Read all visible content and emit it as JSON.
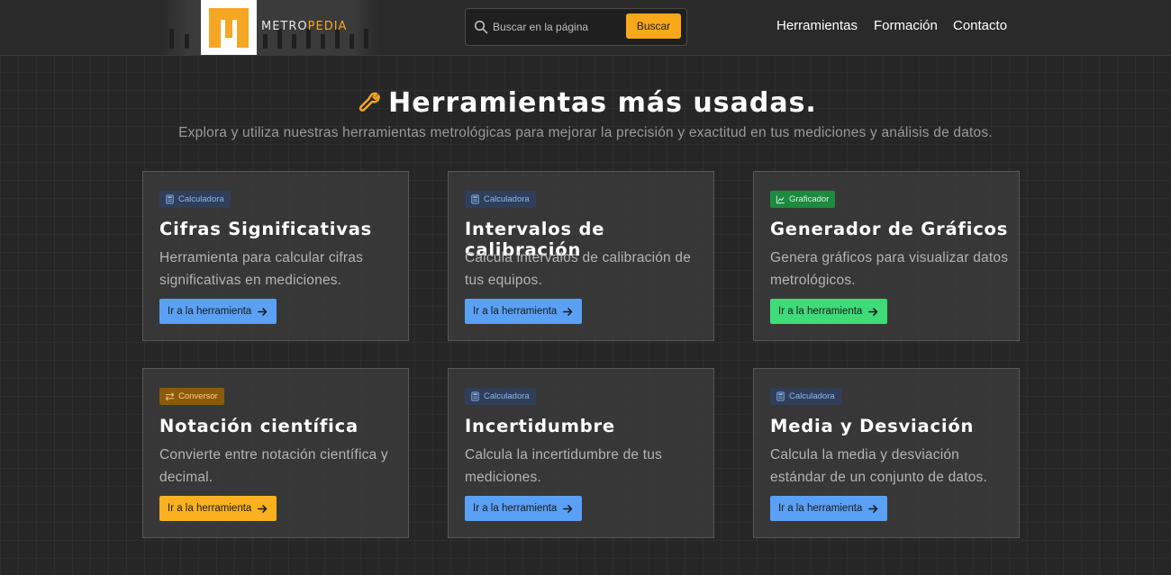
{
  "header": {
    "logo": {
      "text_main": "METRO",
      "text_accent": "PEDIA",
      "accent_color": "#f5a623"
    },
    "search": {
      "placeholder": "Buscar en la página",
      "button_label": "Buscar"
    },
    "nav": [
      "Herramientas",
      "Formación",
      "Contacto"
    ]
  },
  "hero": {
    "title": "Herramientas más usadas.",
    "title_icon": "wrench-icon",
    "subtitle": "Explora y utiliza nuestras herramientas metrológicas para mejorar la precisión y exactitud en tus mediciones y análisis de datos."
  },
  "cards": [
    {
      "badge": "Calculadora",
      "badge_icon": "calculator-icon",
      "title": "Cifras Significativas",
      "description": "Herramienta para calcular cifras significativas en mediciones.",
      "button": "Ir a la herramienta",
      "color": "#5aa0f5"
    },
    {
      "badge": "Calculadora",
      "badge_icon": "calculator-icon",
      "title": "Intervalos de calibración",
      "description": "Calcula intervalos de calibración de tus equipos.",
      "button": "Ir a la herramienta",
      "color": "#5aa0f5"
    },
    {
      "badge": "Graficador",
      "badge_icon": "chart-icon",
      "title": "Generador de Gráficos",
      "description": "Genera gráficos para visualizar datos metrológicos.",
      "button": "Ir a la herramienta",
      "color": "#3edb79"
    },
    {
      "badge": "Conversor",
      "badge_icon": "exchange-icon",
      "title": "Notación científica",
      "description": "Convierte entre notación científica y decimal.",
      "button": "Ir a la herramienta",
      "color": "#f9b021"
    },
    {
      "badge": "Calculadora",
      "badge_icon": "calculator-icon",
      "title": "Incertidumbre",
      "description": "Calcula la incertidumbre de tus mediciones.",
      "button": "Ir a la herramienta",
      "color": "#5aa0f5"
    },
    {
      "badge": "Calculadora",
      "badge_icon": "calculator-icon",
      "title": "Media y Desviación",
      "description": "Calcula la media y desviación estándar de un conjunto de datos.",
      "button": "Ir a la herramienta",
      "color": "#5aa0f5"
    }
  ]
}
